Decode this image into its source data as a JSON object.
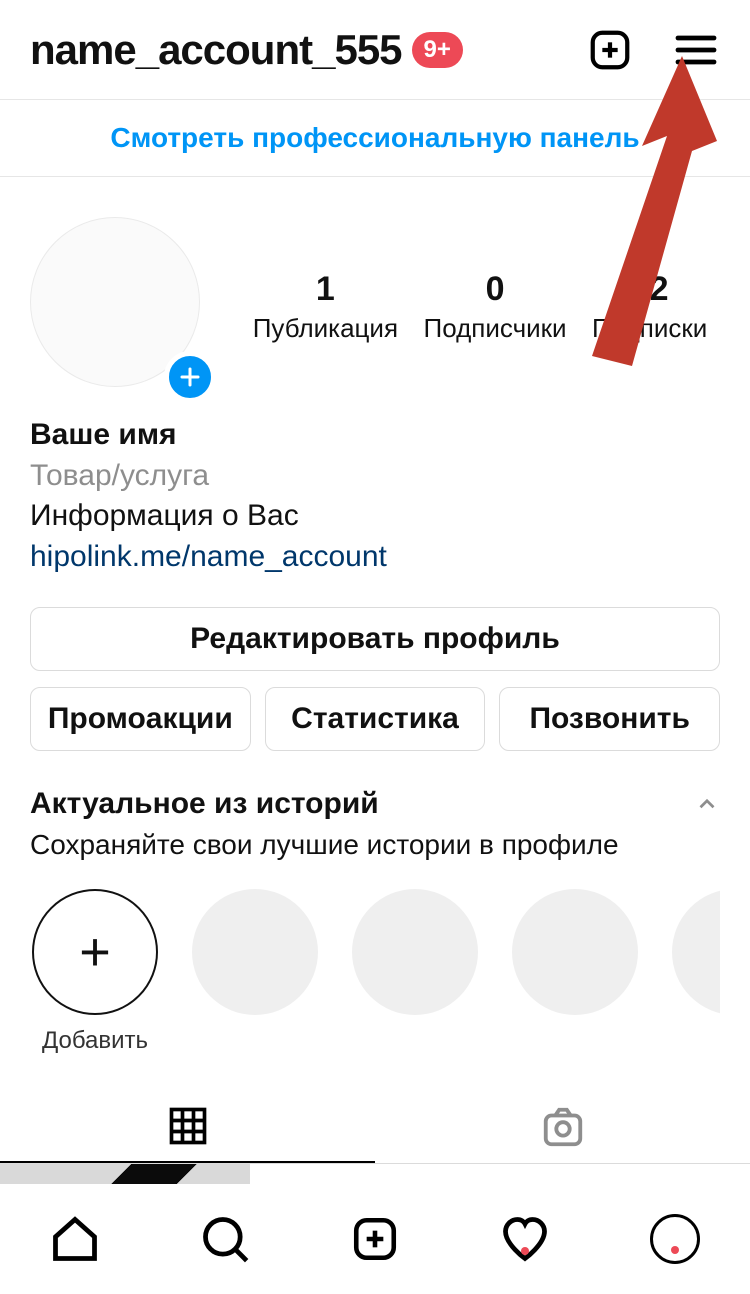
{
  "header": {
    "username": "name_account_555",
    "badge": "9+"
  },
  "pro_panel": "Смотреть профессиональную панель",
  "stats": {
    "posts": {
      "value": "1",
      "label": "Публикация"
    },
    "followers": {
      "value": "0",
      "label": "Подписчики"
    },
    "following": {
      "value": "42",
      "label": "Подписки"
    }
  },
  "bio": {
    "display_name": "Ваше имя",
    "category": "Товар/услуга",
    "description": "Информация о Вас",
    "link": "hipolink.me/name_account"
  },
  "buttons": {
    "edit_profile": "Редактировать профиль",
    "promotions": "Промоакции",
    "insights": "Статистика",
    "call": "Позвонить"
  },
  "highlights": {
    "title": "Актуальное из историй",
    "subtitle": "Сохраняйте свои лучшие истории в профиле",
    "add_label": "Добавить"
  }
}
